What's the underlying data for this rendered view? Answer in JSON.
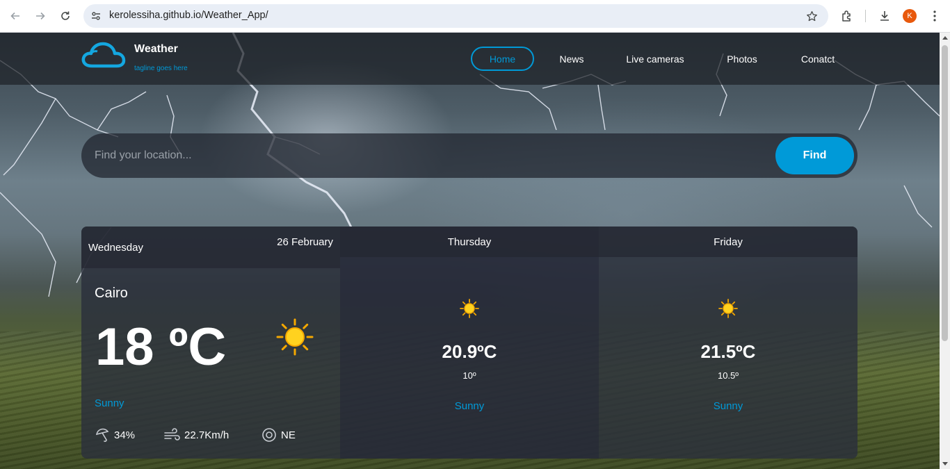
{
  "browser": {
    "url": "kerolessiha.github.io/Weather_App/",
    "profile_initial": "K",
    "profile_color": "#e8590c"
  },
  "site": {
    "brand": "Weather",
    "tagline": "tagline goes here",
    "accent_color": "#009ad8",
    "menu": [
      {
        "label": "Home",
        "active": true
      },
      {
        "label": "News",
        "active": false
      },
      {
        "label": "Live cameras",
        "active": false
      },
      {
        "label": "Photos",
        "active": false
      },
      {
        "label": "Conatct",
        "active": false
      }
    ]
  },
  "search": {
    "placeholder": "Find your location...",
    "button_label": "Find"
  },
  "forecast": {
    "today": {
      "day": "Wednesday",
      "date": "26 February",
      "city": "Cairo",
      "temp": "18 ºC",
      "condition": "Sunny",
      "icon": "sun-icon",
      "humidity": "34%",
      "wind_speed": "22.7Km/h",
      "wind_dir": "NE"
    },
    "days": [
      {
        "day": "Thursday",
        "max": "20.9ºC",
        "min": "10º",
        "condition": "Sunny",
        "icon": "sun-icon"
      },
      {
        "day": "Friday",
        "max": "21.5ºC",
        "min": "10.5º",
        "condition": "Sunny",
        "icon": "sun-icon"
      }
    ]
  }
}
